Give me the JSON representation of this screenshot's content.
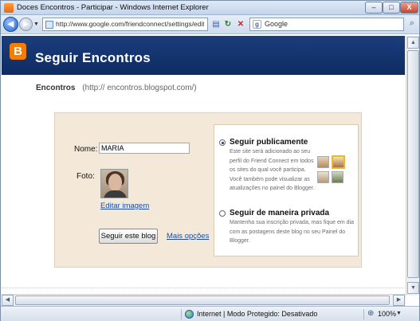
{
  "window": {
    "title": "Doces Encontros - Participar - Windows Internet Explorer",
    "minimize": "–",
    "maximize": "□",
    "close": "X"
  },
  "address_bar": {
    "url": "http://www.google.com/friendconnect/settings/edit",
    "search_placeholder": "Google"
  },
  "header": {
    "logo_letter": "B",
    "title": "Seguir Encontros"
  },
  "blog": {
    "name": "Encontros",
    "url": "(http://          encontros.blogspot.com/)"
  },
  "form": {
    "name_label": "Nome:",
    "name_value": "MARIA",
    "photo_label": "Foto:",
    "edit_image_link": "Editar imagem",
    "follow_button": "Seguir este blog",
    "more_options_link": "Mais opções"
  },
  "options": {
    "public": {
      "title": "Seguir publicamente",
      "description": "Este site será adicionado ao seu perfil do Friend Connect em todos os sites do qual você participa. Você também pode visualizar as atualizações no painel do Blogger.",
      "selected": true
    },
    "private": {
      "title": "Seguir de maneira privada",
      "description": "Mantenha sua inscrição privada, mas fique em dia com as postagens deste blog no seu Painel do Blogger.",
      "selected": false
    }
  },
  "status_bar": {
    "zone": "Internet | Modo Protegido: Desativado",
    "zoom": "100%"
  },
  "colors": {
    "header_bg": "#163671",
    "panel_bg": "#f4e9d9",
    "link": "#1a4ba8",
    "blogger_orange": "#f57d00"
  }
}
